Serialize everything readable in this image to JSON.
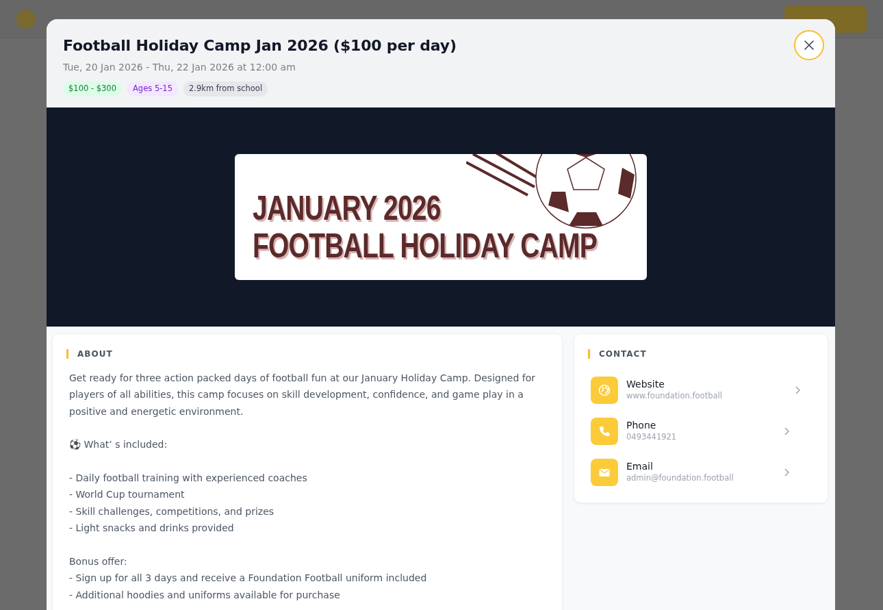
{
  "modal": {
    "title": "Football Holiday Camp Jan 2026 ($100 per day)",
    "date": "Tue, 20 Jan 2026 - Thu, 22 Jan 2026 at 12:00 am",
    "tags": [
      {
        "label": "$100 - $300",
        "kind": "price"
      },
      {
        "label": "Ages 5-15",
        "kind": "age"
      },
      {
        "label": "2.9km from school",
        "kind": "distance"
      }
    ],
    "banner": {
      "lines": [
        "JANUARY 2026",
        "FOOTBALL HOLIDAY CAMP"
      ]
    },
    "about": {
      "heading": "ABOUT",
      "paragraphs": [
        "Get ready for three action packed days of football fun at our January Holiday Camp. Designed for players of all abilities, this camp focuses on skill development, confidence, and game play in a positive and energetic environment.",
        "⚽ What’ s included:",
        "- Daily football training with experienced coaches\n- World Cup tournament\n- Skill challenges, competitions, and prizes\n- Light snacks and drinks provided",
        "Bonus offer:\n- Sign up for all 3 days and receive a Foundation Football uniform included\n- Additional hoodies and uniforms available for purchase"
      ]
    },
    "contact": {
      "heading": "CONTACT",
      "items": [
        {
          "kind": "website",
          "label": "Website",
          "value": "www.foundation.football"
        },
        {
          "kind": "phone",
          "label": "Phone",
          "value": "0493441921"
        },
        {
          "kind": "email",
          "label": "Email",
          "value": "admin@foundation.football"
        }
      ]
    }
  }
}
